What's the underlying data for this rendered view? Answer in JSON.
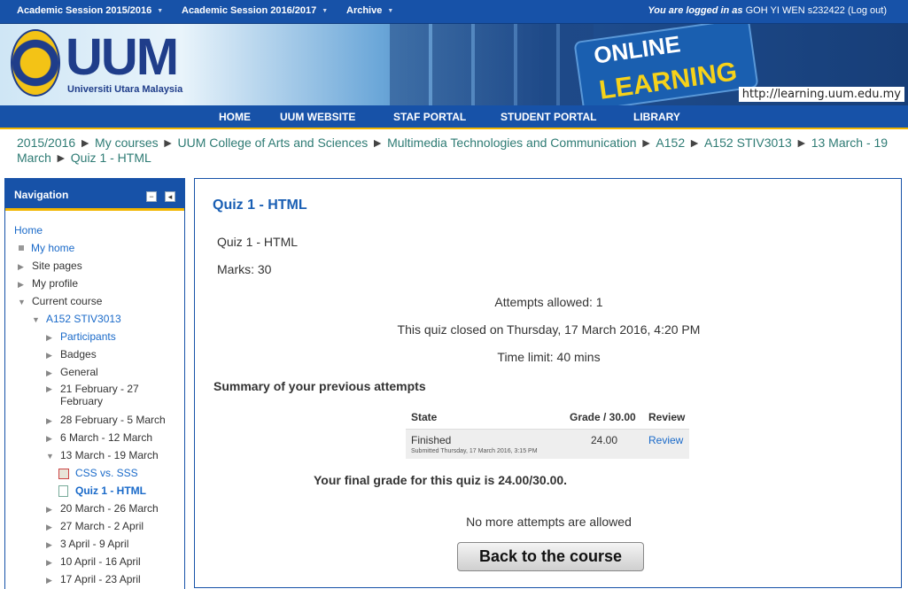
{
  "topbar": {
    "menus": [
      "Academic Session 2015/2016",
      "Academic Session 2016/2017",
      "Archive"
    ],
    "login_prefix": "You are logged in as",
    "user": "GOH YI WEN s232422",
    "logout": "(Log out)"
  },
  "banner": {
    "logo_text": "UUM",
    "logo_sub": "Universiti Utara Malaysia",
    "online": "ONLINE",
    "learning": "LEARNING",
    "url": "http://learning.uum.edu.my"
  },
  "mainnav": [
    "HOME",
    "UUM WEBSITE",
    "STAF PORTAL",
    "STUDENT PORTAL",
    "LIBRARY"
  ],
  "breadcrumb": [
    "2015/2016",
    "My courses",
    "UUM College of Arts and Sciences",
    "Multimedia Technologies and Communication",
    "A152",
    "A152 STIV3013",
    "13 March - 19 March",
    "Quiz 1 - HTML"
  ],
  "breadcrumb_sep": "►",
  "navigation": {
    "title": "Navigation",
    "items": [
      {
        "label": "Home"
      },
      {
        "label": "My home"
      },
      {
        "label": "Site pages"
      },
      {
        "label": "My profile"
      },
      {
        "label": "Current course"
      },
      {
        "label": "A152 STIV3013"
      },
      {
        "label": "Participants"
      },
      {
        "label": "Badges"
      },
      {
        "label": "General"
      },
      {
        "label": "21 February - 27 February"
      },
      {
        "label": "28 February - 5 March"
      },
      {
        "label": "6 March - 12 March"
      },
      {
        "label": "13 March - 19 March"
      },
      {
        "label": "CSS vs. SSS"
      },
      {
        "label": "Quiz 1 - HTML"
      },
      {
        "label": "20 March - 26 March"
      },
      {
        "label": "27 March - 2 April"
      },
      {
        "label": "3 April - 9 April"
      },
      {
        "label": "10 April - 16 April"
      },
      {
        "label": "17 April - 23 April"
      }
    ]
  },
  "quiz": {
    "title": "Quiz 1 - HTML",
    "name": "Quiz 1 - HTML",
    "marks": "Marks: 30",
    "attempts_allowed": "Attempts allowed: 1",
    "closed": "This quiz closed on Thursday, 17 March 2016, 4:20 PM",
    "time_limit": "Time limit: 40 mins",
    "summary_heading": "Summary of your previous attempts",
    "table": {
      "headers": [
        "State",
        "Grade / 30.00",
        "Review"
      ],
      "row": {
        "state": "Finished",
        "submitted": "Submitted Thursday, 17 March 2016, 3:15 PM",
        "grade": "24.00",
        "review": "Review"
      }
    },
    "final_grade": "Your final grade for this quiz is 24.00/30.00.",
    "no_more": "No more attempts are allowed",
    "back_button": "Back to the course"
  }
}
